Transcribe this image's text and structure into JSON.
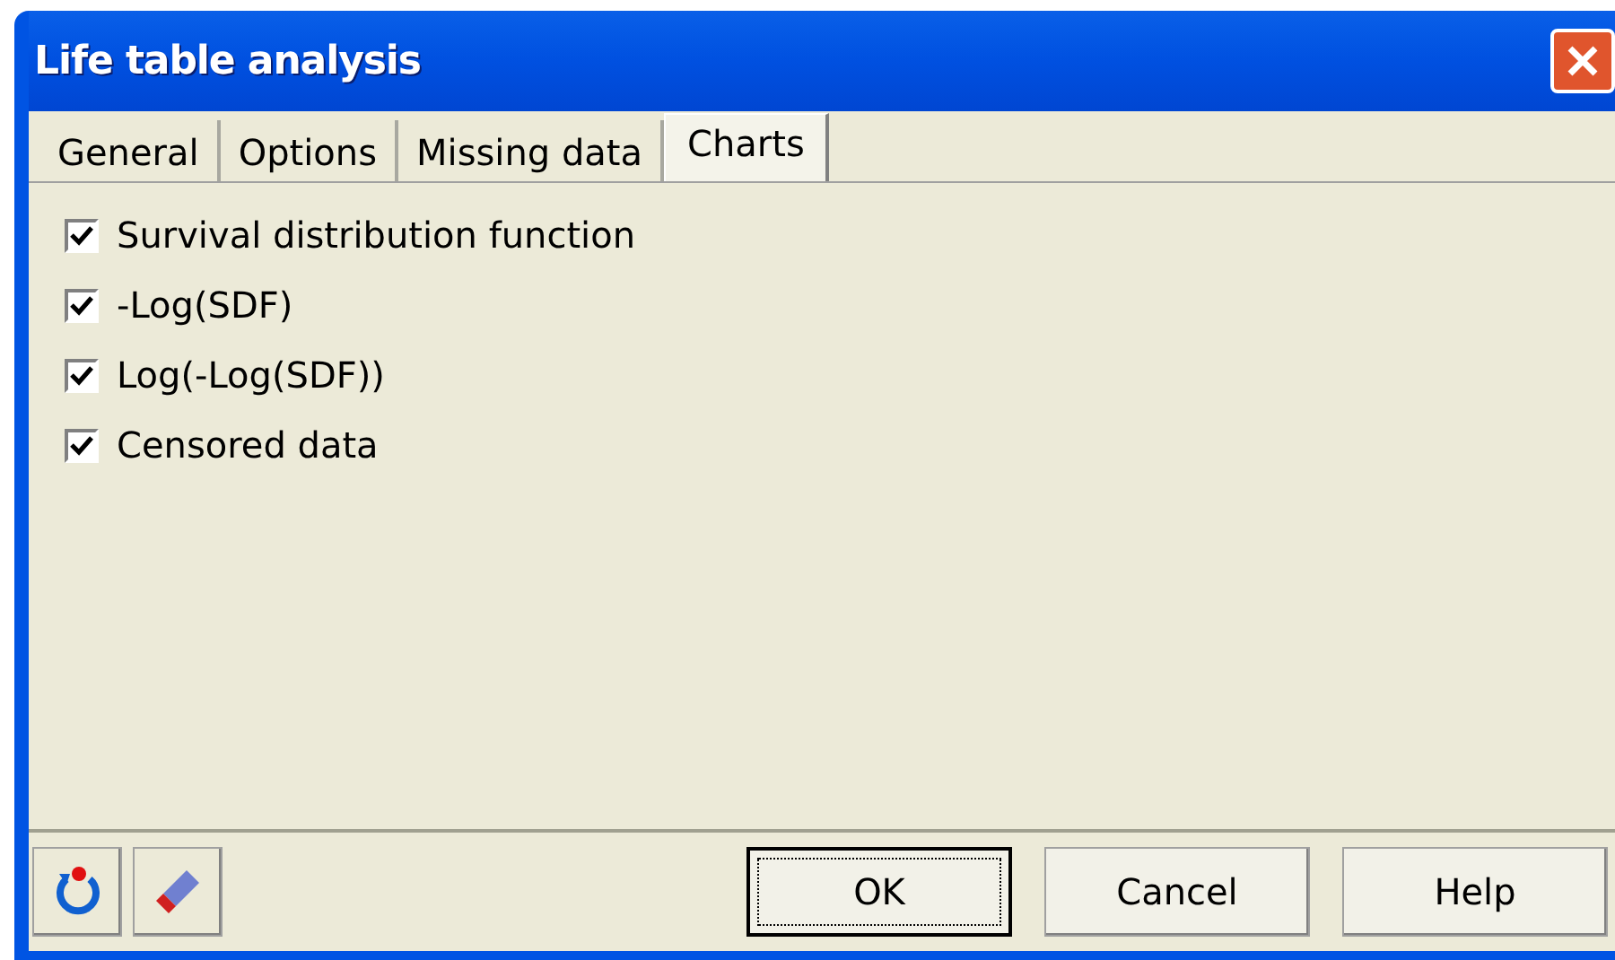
{
  "window": {
    "title": "Life table analysis"
  },
  "tabs": [
    {
      "label": "General",
      "selected": false
    },
    {
      "label": "Options",
      "selected": false
    },
    {
      "label": "Missing data",
      "selected": false
    },
    {
      "label": "Charts",
      "selected": true
    }
  ],
  "options": [
    {
      "label": "Survival distribution function",
      "checked": true
    },
    {
      "label": "-Log(SDF)",
      "checked": true
    },
    {
      "label": "Log(-Log(SDF))",
      "checked": true
    },
    {
      "label": "Censored data",
      "checked": true
    }
  ],
  "buttons": [
    {
      "label": "OK",
      "default": true
    },
    {
      "label": "Cancel",
      "default": false
    },
    {
      "label": "Help",
      "default": false
    }
  ]
}
